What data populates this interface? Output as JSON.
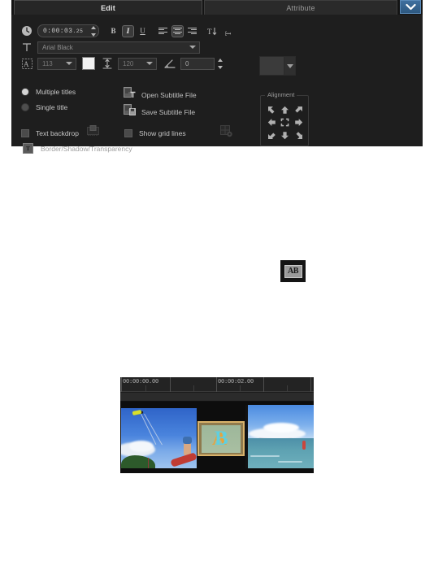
{
  "tabs": {
    "edit_label": "Edit",
    "attribute_label": "Attribute",
    "chevron_icon": "chevron-down-icon",
    "active": "Edit"
  },
  "toolbar": {
    "clock_icon": "clock-icon",
    "timecode_main": "0:00:03",
    "timecode_frames": ".25",
    "bold_label": "B",
    "italic_label": "I",
    "underline_label": "U",
    "align_left_icon": "align-left-icon",
    "align_center_icon": "align-center-icon",
    "align_right_icon": "align-right-icon",
    "text_vertical_icon": "text-direction-vertical-icon",
    "text_horizontal_icon": "text-direction-horizontal-icon",
    "bold_on": false,
    "italic_on": true,
    "underline_on": false,
    "paragraph_align": "center"
  },
  "font": {
    "type_icon": "text-type-icon",
    "family_value": "Arial Black",
    "size_icon": "font-size-icon",
    "size_value": "113",
    "color_value": "#f2f2f2",
    "line_spacing_icon": "line-spacing-icon",
    "line_spacing_value": "120",
    "rotation_icon": "rotation-angle-icon",
    "rotation_value": "0"
  },
  "options": {
    "multiple_titles_label": "Multiple titles",
    "multiple_titles_checked": true,
    "single_title_label": "Single title",
    "single_title_checked": false,
    "text_backdrop_label": "Text backdrop",
    "text_backdrop_checked": false,
    "show_grid_lines_label": "Show grid lines",
    "show_grid_lines_checked": false,
    "backdrop_settings_icon": "backdrop-settings-icon",
    "grid_settings_icon": "grid-settings-icon"
  },
  "subtitle": {
    "open_icon": "open-subtitle-file-icon",
    "open_label": "Open Subtitle File",
    "save_icon": "save-subtitle-file-icon",
    "save_label": "Save Subtitle File"
  },
  "border_shadow": {
    "icon": "text-effects-icon",
    "label": "Border/Shadow/Transparency"
  },
  "color_picker": {
    "swatch_color": "#3b3b3b",
    "dropdown_icon": "chevron-down-icon"
  },
  "alignment": {
    "legend": "Alignment",
    "cells": [
      {
        "name": "align-top-left",
        "icon": "arrow-up-left-icon"
      },
      {
        "name": "align-top-center",
        "icon": "arrow-up-icon"
      },
      {
        "name": "align-top-right",
        "icon": "arrow-up-right-icon"
      },
      {
        "name": "align-middle-left",
        "icon": "arrow-left-icon"
      },
      {
        "name": "align-center",
        "icon": "center-target-icon"
      },
      {
        "name": "align-middle-right",
        "icon": "arrow-right-icon"
      },
      {
        "name": "align-bottom-left",
        "icon": "arrow-down-left-icon"
      },
      {
        "name": "align-bottom-center",
        "icon": "arrow-down-icon"
      },
      {
        "name": "align-bottom-right",
        "icon": "arrow-down-right-icon"
      }
    ]
  },
  "floating_icon": {
    "name": "title-ab-icon",
    "label": "AB"
  },
  "timeline": {
    "ruler_labels": [
      "00:00:00.00",
      "00:00:02.00"
    ],
    "clips": [
      {
        "name": "video-clip-kitesurf-launch",
        "selected": false
      },
      {
        "name": "title-clip-ab",
        "selected": true,
        "glyph_a": "A",
        "glyph_b": "B"
      },
      {
        "name": "video-clip-ocean-ride",
        "selected": false
      }
    ]
  }
}
